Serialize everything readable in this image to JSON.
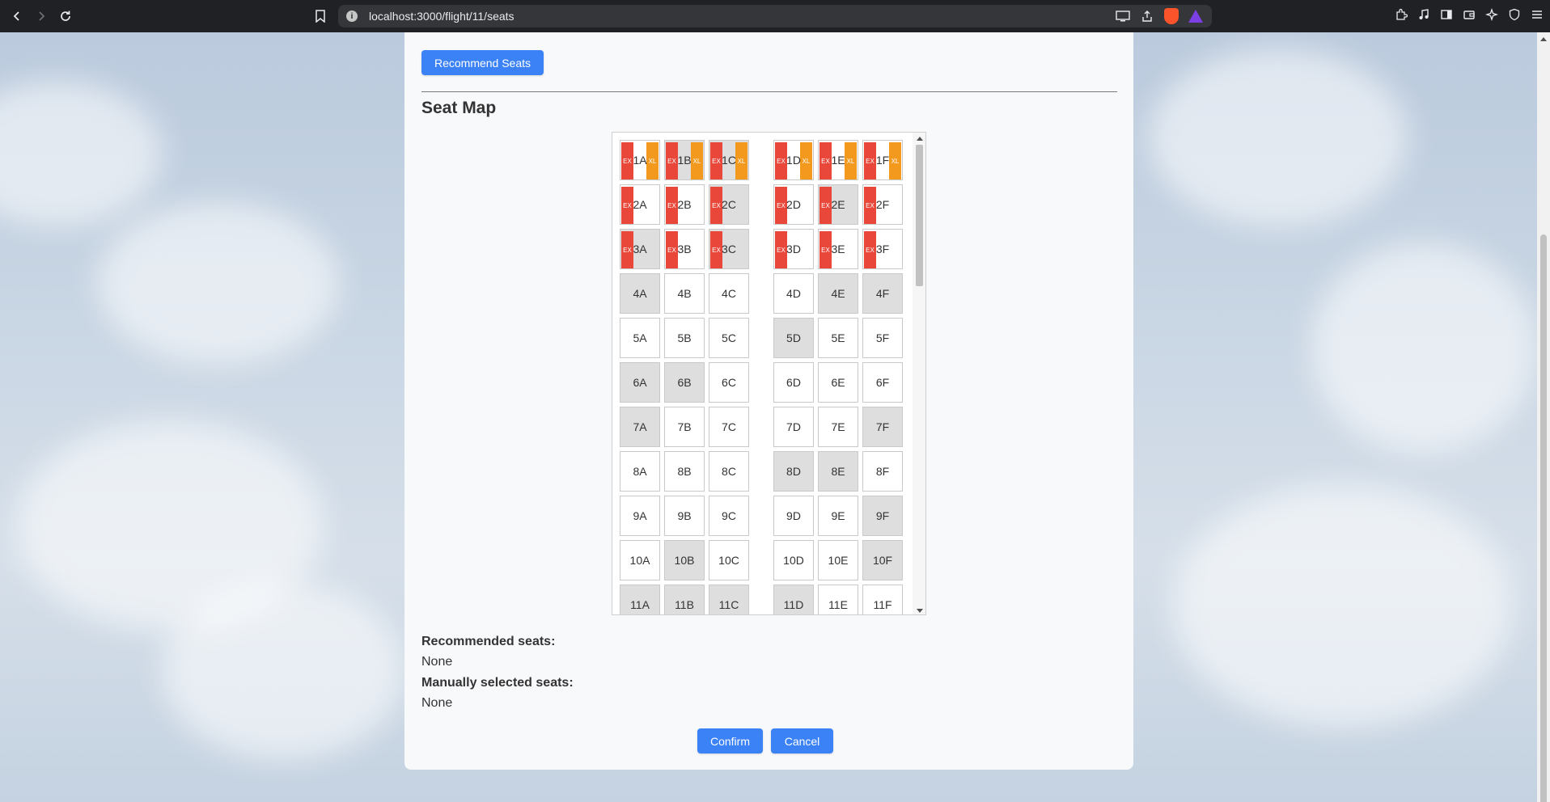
{
  "browser": {
    "url": "localhost:3000/flight/11/seats"
  },
  "page": {
    "recommend_button": "Recommend Seats",
    "title": "Seat Map",
    "recommended_label": "Recommended seats:",
    "recommended_value": "None",
    "manual_label": "Manually selected seats:",
    "manual_value": "None",
    "confirm_button": "Confirm",
    "cancel_button": "Cancel"
  },
  "seat_tags": {
    "exit": "EX",
    "extra_legroom": "XL"
  },
  "colors": {
    "accent_blue": "#3b82f6",
    "exit_red": "#e8473a",
    "xl_orange": "#f39a1e",
    "occupied_gray": "#dedede"
  },
  "seats": {
    "rows": [
      {
        "row": "1",
        "seats": [
          {
            "label": "1A",
            "occupied": false,
            "exit": true,
            "xl": true
          },
          {
            "label": "1B",
            "occupied": true,
            "exit": true,
            "xl": true
          },
          {
            "label": "1C",
            "occupied": true,
            "exit": true,
            "xl": true
          },
          {
            "label": "1D",
            "occupied": false,
            "exit": true,
            "xl": true
          },
          {
            "label": "1E",
            "occupied": false,
            "exit": true,
            "xl": true
          },
          {
            "label": "1F",
            "occupied": false,
            "exit": true,
            "xl": true
          }
        ]
      },
      {
        "row": "2",
        "seats": [
          {
            "label": "2A",
            "occupied": false,
            "exit": true,
            "xl": false
          },
          {
            "label": "2B",
            "occupied": false,
            "exit": true,
            "xl": false
          },
          {
            "label": "2C",
            "occupied": true,
            "exit": true,
            "xl": false
          },
          {
            "label": "2D",
            "occupied": false,
            "exit": true,
            "xl": false
          },
          {
            "label": "2E",
            "occupied": true,
            "exit": true,
            "xl": false
          },
          {
            "label": "2F",
            "occupied": false,
            "exit": true,
            "xl": false
          }
        ]
      },
      {
        "row": "3",
        "seats": [
          {
            "label": "3A",
            "occupied": true,
            "exit": true,
            "xl": false
          },
          {
            "label": "3B",
            "occupied": false,
            "exit": true,
            "xl": false
          },
          {
            "label": "3C",
            "occupied": true,
            "exit": true,
            "xl": false
          },
          {
            "label": "3D",
            "occupied": false,
            "exit": true,
            "xl": false
          },
          {
            "label": "3E",
            "occupied": false,
            "exit": true,
            "xl": false
          },
          {
            "label": "3F",
            "occupied": false,
            "exit": true,
            "xl": false
          }
        ]
      },
      {
        "row": "4",
        "seats": [
          {
            "label": "4A",
            "occupied": true
          },
          {
            "label": "4B",
            "occupied": false
          },
          {
            "label": "4C",
            "occupied": false
          },
          {
            "label": "4D",
            "occupied": false
          },
          {
            "label": "4E",
            "occupied": true
          },
          {
            "label": "4F",
            "occupied": true
          }
        ]
      },
      {
        "row": "5",
        "seats": [
          {
            "label": "5A",
            "occupied": false
          },
          {
            "label": "5B",
            "occupied": false
          },
          {
            "label": "5C",
            "occupied": false
          },
          {
            "label": "5D",
            "occupied": true
          },
          {
            "label": "5E",
            "occupied": false
          },
          {
            "label": "5F",
            "occupied": false
          }
        ]
      },
      {
        "row": "6",
        "seats": [
          {
            "label": "6A",
            "occupied": true
          },
          {
            "label": "6B",
            "occupied": true
          },
          {
            "label": "6C",
            "occupied": false
          },
          {
            "label": "6D",
            "occupied": false
          },
          {
            "label": "6E",
            "occupied": false
          },
          {
            "label": "6F",
            "occupied": false
          }
        ]
      },
      {
        "row": "7",
        "seats": [
          {
            "label": "7A",
            "occupied": true
          },
          {
            "label": "7B",
            "occupied": false
          },
          {
            "label": "7C",
            "occupied": false
          },
          {
            "label": "7D",
            "occupied": false
          },
          {
            "label": "7E",
            "occupied": false
          },
          {
            "label": "7F",
            "occupied": true
          }
        ]
      },
      {
        "row": "8",
        "seats": [
          {
            "label": "8A",
            "occupied": false
          },
          {
            "label": "8B",
            "occupied": false
          },
          {
            "label": "8C",
            "occupied": false
          },
          {
            "label": "8D",
            "occupied": true
          },
          {
            "label": "8E",
            "occupied": true
          },
          {
            "label": "8F",
            "occupied": false
          }
        ]
      },
      {
        "row": "9",
        "seats": [
          {
            "label": "9A",
            "occupied": false
          },
          {
            "label": "9B",
            "occupied": false
          },
          {
            "label": "9C",
            "occupied": false
          },
          {
            "label": "9D",
            "occupied": false
          },
          {
            "label": "9E",
            "occupied": false
          },
          {
            "label": "9F",
            "occupied": true
          }
        ]
      },
      {
        "row": "10",
        "seats": [
          {
            "label": "10A",
            "occupied": false
          },
          {
            "label": "10B",
            "occupied": true
          },
          {
            "label": "10C",
            "occupied": false
          },
          {
            "label": "10D",
            "occupied": false
          },
          {
            "label": "10E",
            "occupied": false
          },
          {
            "label": "10F",
            "occupied": true
          }
        ]
      },
      {
        "row": "11",
        "seats": [
          {
            "label": "11A",
            "occupied": true
          },
          {
            "label": "11B",
            "occupied": true
          },
          {
            "label": "11C",
            "occupied": true
          },
          {
            "label": "11D",
            "occupied": true
          },
          {
            "label": "11E",
            "occupied": false
          },
          {
            "label": "11F",
            "occupied": false
          }
        ]
      }
    ]
  }
}
